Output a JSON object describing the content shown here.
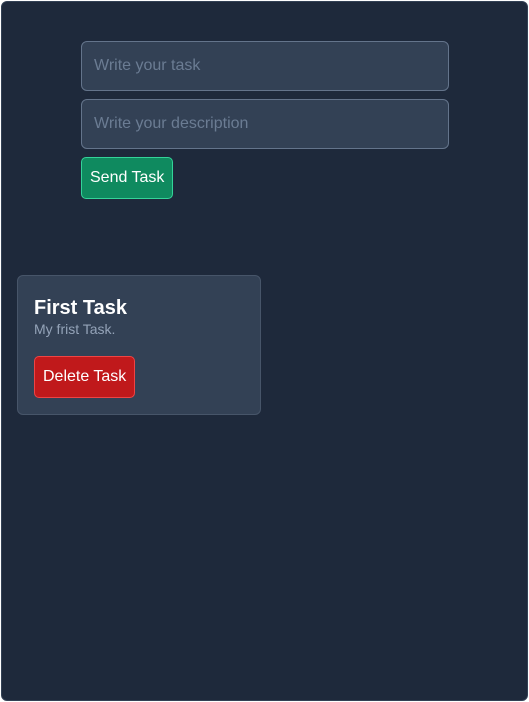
{
  "form": {
    "task_placeholder": "Write your task",
    "task_value": "",
    "description_placeholder": "Write your description",
    "description_value": "",
    "send_label": "Send Task"
  },
  "tasks": [
    {
      "title": "First Task",
      "description": "My frist Task.",
      "delete_label": "Delete Task"
    }
  ],
  "colors": {
    "background": "#1e293b",
    "card": "#334155",
    "send_button": "#0f8a5f",
    "delete_button": "#c0191b"
  }
}
